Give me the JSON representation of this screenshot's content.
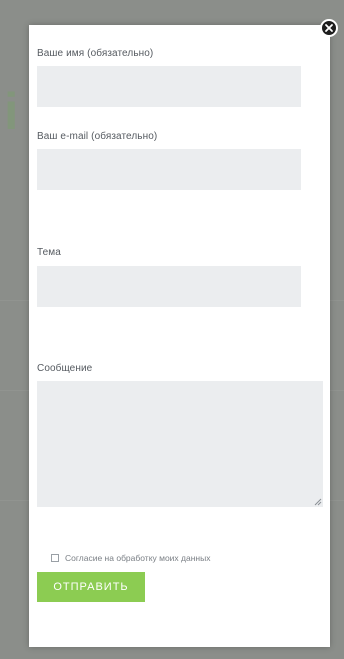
{
  "background": {
    "decor_letter": "i"
  },
  "form": {
    "fields": [
      {
        "label": "Ваше имя (обязательно)",
        "value": ""
      },
      {
        "label": "Ваш e-mail (обязательно)",
        "value": ""
      },
      {
        "label": "Тема",
        "value": ""
      }
    ],
    "message": {
      "label": "Сообщение",
      "value": ""
    },
    "consent": {
      "label": "Согласие на обработку моих данных",
      "checked": false
    },
    "submit_label": "ОТПРАВИТЬ"
  },
  "colors": {
    "submit_button": "#8ccc52",
    "input_background": "#ebedef",
    "overlay": "#8b8e8a"
  },
  "icons": {
    "close": "close-icon",
    "resize": "resize-grip-icon"
  }
}
